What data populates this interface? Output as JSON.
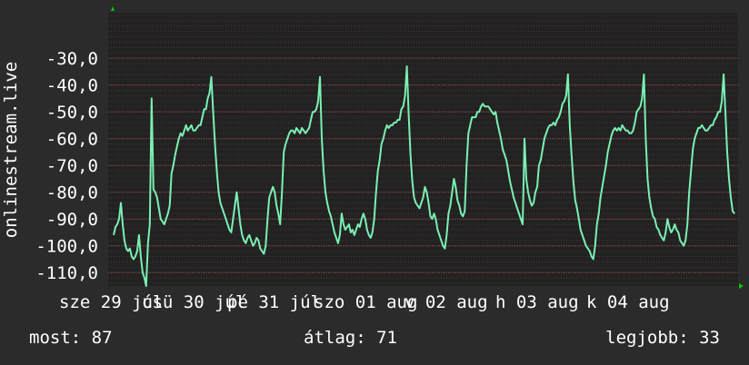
{
  "colors": {
    "background": "#2b2b2b",
    "plot_background": "#222222",
    "line": "#7af0b4",
    "grid": "#6a3f3f",
    "axis_marker": "#00cc00"
  },
  "chart_data": {
    "type": "line",
    "ylabel": "onlinestream.live",
    "y_ticks": [
      -30,
      -40,
      -50,
      -60,
      -70,
      -80,
      -90,
      -100,
      -110
    ],
    "y_tick_labels": [
      "-30,0",
      "-40,0",
      "-50,0",
      "-60,0",
      "-70,0",
      "-80,0",
      "-90,0",
      "-100,0",
      "-110,0"
    ],
    "ylim": [
      -115,
      -13
    ],
    "x_tick_labels": [
      "sze 29 júl",
      "csü 30 júl",
      "pé 31 júl",
      "szo 01 aug",
      "v 02 aug",
      "h 03 aug",
      "k 04 aug"
    ],
    "grid": true,
    "series": [
      {
        "values": [
          -96,
          -93,
          -92,
          -90,
          -84,
          -92,
          -98,
          -101,
          -102,
          -101,
          -104,
          -105,
          -104,
          -102,
          -96,
          -104,
          -110,
          -112,
          -115,
          -99,
          -92,
          -45,
          -79,
          -80,
          -82,
          -86,
          -90,
          -91,
          -92,
          -90,
          -88,
          -85,
          -73,
          -70,
          -66,
          -63,
          -60,
          -58,
          -59,
          -57,
          -55,
          -57,
          -56,
          -55,
          -57,
          -57,
          -56,
          -55,
          -55,
          -52,
          -49,
          -49,
          -45,
          -43,
          -37,
          -50,
          -62,
          -72,
          -80,
          -84,
          -86,
          -88,
          -90,
          -92,
          -94,
          -95,
          -90,
          -85,
          -80,
          -86,
          -92,
          -96,
          -98,
          -99,
          -97,
          -96,
          -98,
          -100,
          -99,
          -97,
          -98,
          -101,
          -102,
          -103,
          -100,
          -90,
          -82,
          -80,
          -78,
          -80,
          -85,
          -88,
          -92,
          -80,
          -65,
          -62,
          -60,
          -58,
          -57,
          -57,
          -58,
          -56,
          -57,
          -58,
          -56,
          -57,
          -58,
          -57,
          -56,
          -53,
          -50,
          -50,
          -49,
          -46,
          -37,
          -60,
          -72,
          -80,
          -84,
          -87,
          -89,
          -92,
          -95,
          -97,
          -99,
          -96,
          -88,
          -92,
          -94,
          -93,
          -92,
          -95,
          -94,
          -96,
          -94,
          -92,
          -93,
          -90,
          -88,
          -90,
          -94,
          -96,
          -97,
          -95,
          -90,
          -80,
          -72,
          -68,
          -62,
          -60,
          -57,
          -55,
          -56,
          -55,
          -55,
          -54,
          -54,
          -53,
          -53,
          -49,
          -48,
          -44,
          -33,
          -51,
          -66,
          -76,
          -82,
          -84,
          -85,
          -86,
          -84,
          -82,
          -78,
          -80,
          -84,
          -89,
          -90,
          -88,
          -90,
          -94,
          -96,
          -98,
          -100,
          -101,
          -96,
          -88,
          -85,
          -80,
          -75,
          -78,
          -83,
          -85,
          -88,
          -89,
          -87,
          -70,
          -58,
          -55,
          -52,
          -52,
          -52,
          -50,
          -50,
          -48,
          -47,
          -48,
          -48,
          -48,
          -49,
          -50,
          -51,
          -50,
          -54,
          -57,
          -60,
          -64,
          -66,
          -68,
          -72,
          -76,
          -79,
          -82,
          -84,
          -86,
          -88,
          -90,
          -92,
          -60,
          -75,
          -80,
          -83,
          -85,
          -84,
          -80,
          -78,
          -70,
          -68,
          -64,
          -60,
          -58,
          -56,
          -55,
          -55,
          -54,
          -55,
          -53,
          -52,
          -50,
          -47,
          -46,
          -44,
          -36,
          -55,
          -66,
          -76,
          -83,
          -86,
          -90,
          -94,
          -96,
          -98,
          -100,
          -101,
          -102,
          -104,
          -105,
          -100,
          -92,
          -88,
          -82,
          -78,
          -74,
          -70,
          -65,
          -62,
          -59,
          -57,
          -56,
          -57,
          -56,
          -57,
          -55,
          -56,
          -57,
          -57,
          -58,
          -58,
          -57,
          -54,
          -50,
          -49,
          -48,
          -45,
          -36,
          -60,
          -75,
          -82,
          -86,
          -89,
          -90,
          -93,
          -94,
          -96,
          -97,
          -98,
          -95,
          -90,
          -93,
          -95,
          -94,
          -92,
          -94,
          -95,
          -98,
          -99,
          -100,
          -98,
          -92,
          -80,
          -72,
          -64,
          -60,
          -58,
          -56,
          -56,
          -55,
          -56,
          -57,
          -57,
          -56,
          -55,
          -55,
          -53,
          -52,
          -50,
          -50,
          -46,
          -36,
          -50,
          -65,
          -75,
          -82,
          -87,
          -88
        ]
      }
    ]
  },
  "stats": {
    "now": "most: 87",
    "avg": "átlag: 71",
    "best": "legjobb: 33"
  }
}
